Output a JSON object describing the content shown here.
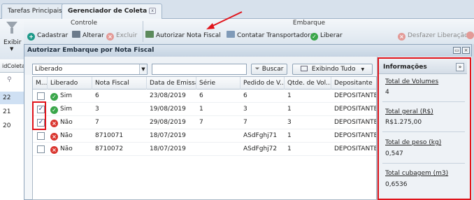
{
  "tabs": [
    {
      "label": "Tarefas Principais"
    },
    {
      "label": "Gerenciador de Coleta",
      "close": "x"
    }
  ],
  "ribbon": {
    "exibir_label": "Exibir",
    "controle": {
      "title": "Controle",
      "cadastrar": "Cadastrar",
      "alterar": "Alterar",
      "excluir": "Excluir"
    },
    "embarque": {
      "title": "Embarque",
      "autorizar": "Autorizar Nota Fiscal",
      "contatar": "Contatar Transportadora",
      "liberar": "Liberar",
      "desfazer": "Desfazer Liberação"
    }
  },
  "left_grid": {
    "header": "idColeta",
    "rows": [
      "22",
      "21",
      "20"
    ]
  },
  "dialog": {
    "title": "Autorizar Embarque por Nota Fiscal",
    "filter_value": "Liberado",
    "search_value": "",
    "buscar_label": "Buscar",
    "exibindo_label": "Exibindo Tudo",
    "columns": [
      "M...",
      "Liberado",
      "Nota Fiscal",
      "Data de Emissão",
      "Série",
      "Pedido de V...",
      "Qtde. de Vol...",
      "Depositante"
    ],
    "rows": [
      {
        "checked": false,
        "liberado": "Sim",
        "ok": true,
        "nota": "6",
        "data": "23/08/2019",
        "serie": "6",
        "pedido": "6",
        "qtde": "1",
        "depositante": "DEPOSITANTE"
      },
      {
        "checked": true,
        "liberado": "Sim",
        "ok": true,
        "nota": "3",
        "data": "19/08/2019",
        "serie": "1",
        "pedido": "3",
        "qtde": "1",
        "depositante": "DEPOSITANTE"
      },
      {
        "checked": true,
        "liberado": "Não",
        "ok": false,
        "nota": "7",
        "data": "29/08/2019",
        "serie": "7",
        "pedido": "7",
        "qtde": "3",
        "depositante": "DEPOSITANTE"
      },
      {
        "checked": false,
        "liberado": "Não",
        "ok": false,
        "nota": "8710071",
        "data": "18/07/2019",
        "serie": "",
        "pedido": "ASdFghj71",
        "qtde": "1",
        "depositante": "DEPOSITANTE"
      },
      {
        "checked": false,
        "liberado": "Não",
        "ok": false,
        "nota": "8710072",
        "data": "18/07/2019",
        "serie": "",
        "pedido": "ASdFghj72",
        "qtde": "1",
        "depositante": "DEPOSITANTE"
      }
    ]
  },
  "info": {
    "title": "Informações",
    "items": [
      {
        "label": "Total de Volumes",
        "value": "4"
      },
      {
        "label": "Total geral (R$)",
        "value": "R$1.275,00"
      },
      {
        "label": "Total de peso (kg)",
        "value": "0,547"
      },
      {
        "label": "Total cubagem (m3)",
        "value": "0,6536"
      }
    ]
  },
  "colors": {
    "highlight": "#e0141b",
    "ok_green": "#3aa64a",
    "no_red": "#d9362f",
    "add_teal": "#1f9a8a"
  }
}
